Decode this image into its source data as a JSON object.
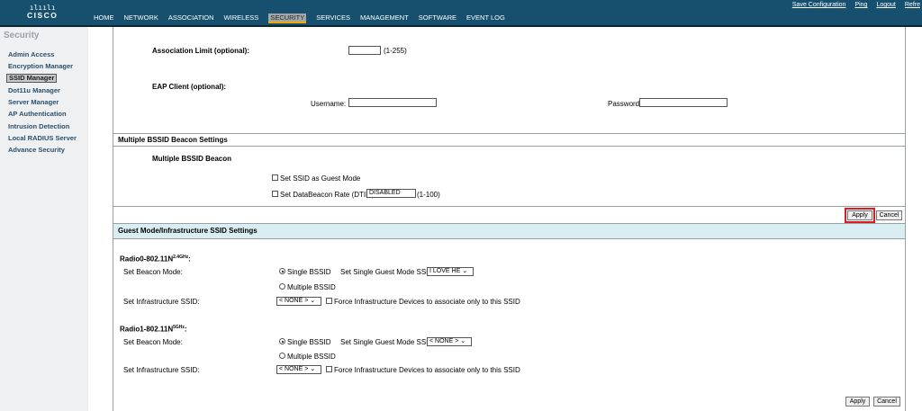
{
  "brand": {
    "bars": "ılıılı",
    "name": "CISCO"
  },
  "nav": [
    "HOME",
    "NETWORK",
    "ASSOCIATION",
    "WIRELESS",
    "SECURITY",
    "SERVICES",
    "MANAGEMENT",
    "SOFTWARE",
    "EVENT LOG"
  ],
  "top_links": [
    "Save Configuration",
    "Ping",
    "Logout",
    "Refre"
  ],
  "sidebar": {
    "heading": "Security",
    "items": [
      "Admin Access",
      "Encryption Manager",
      "SSID Manager",
      "Dot11u Manager",
      "Server Manager",
      "AP Authentication",
      "Intrusion Detection",
      "Local RADIUS Server",
      "Advance Security"
    ],
    "selected": "SSID Manager"
  },
  "assoc": {
    "label": "Association Limit (optional):",
    "hint": "(1-255)",
    "value": ""
  },
  "eap": {
    "label": "EAP Client (optional):",
    "username_label": "Username:",
    "password_label": "Password:",
    "username": "",
    "password": ""
  },
  "mbssid": {
    "section_title": "Multiple BSSID Beacon Settings",
    "sub_title": "Multiple BSSID Beacon",
    "guest_mode_label": "Set SSID as Guest Mode",
    "dtim_label": "Set DataBeacon Rate (DTIM):",
    "dtim_value": "DISABLED",
    "dtim_hint": "(1-100)"
  },
  "buttons": {
    "apply": "Apply",
    "cancel": "Cancel"
  },
  "guest": {
    "section_title": "Guest Mode/Infrastructure SSID Settings",
    "radio0": {
      "name": "Radio0-802.11N",
      "band": "2.4GHz"
    },
    "radio1": {
      "name": "Radio1-802.11N",
      "band": "5GHz"
    },
    "beacon_mode_label": "Set Beacon Mode:",
    "single_bssid": "Single BSSID",
    "multiple_bssid": "Multiple BSSID",
    "guest_ssid_label": "Set Single Guest Mode SSID:",
    "radio0_guest_ssid": "I LOVE HE",
    "radio1_guest_ssid": "< NONE >",
    "infra_label": "Set Infrastructure SSID:",
    "infra_value": "< NONE >",
    "force_label": "Force Infrastructure Devices to associate only to this SSID"
  },
  "colors": {
    "header": "#16506e",
    "sidebar_bg": "#eef0f1",
    "section_bg": "#d9eef2",
    "highlight": "#e0191f"
  }
}
